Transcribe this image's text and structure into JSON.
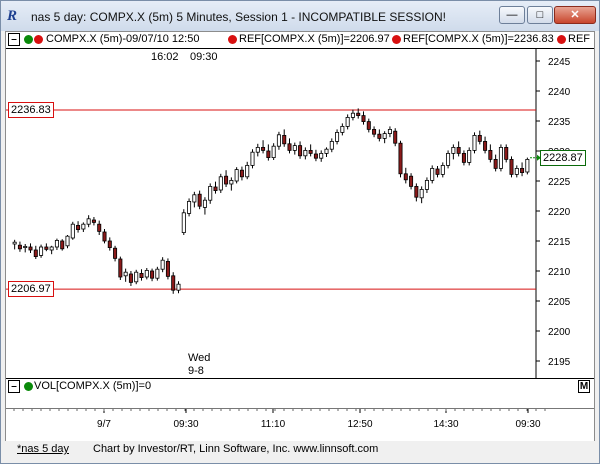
{
  "window": {
    "title": "nas 5 day: COMPX.X (5m) 5 Minutes, Session 1 - INCOMPATIBLE SESSION!",
    "app_icon": "R",
    "controls": {
      "minimize": "—",
      "maximize": "□",
      "close": "✕"
    }
  },
  "legend": {
    "main": "COMPX.X (5m)-09/07/10 12:50",
    "ref1": "REF[COMPX.X (5m)]=2206.97",
    "ref2": "REF[COMPX.X (5m)]=2236.83",
    "ref3": "REF",
    "corner_label": "M"
  },
  "chart_top_text": {
    "time1": "16:02",
    "time2": "09:30"
  },
  "annotation": {
    "day": "Wed",
    "date": "9-8"
  },
  "ref_labels": {
    "upper": "2236.83",
    "lower": "2206.97"
  },
  "last_price": "2228.87",
  "volume": {
    "label": "VOL[COMPX.X (5m)]=0",
    "corner_label": "M"
  },
  "x_axis_labels": [
    "9/7",
    "09:30",
    "11:10",
    "12:50",
    "14:30",
    "09:30"
  ],
  "status": {
    "tab": "*nas 5 day",
    "credit": "Chart by Investor/RT, Linn Software, Inc. www.linnsoft.com"
  },
  "colors": {
    "up": "#ffffff",
    "down": "#8b1a1a",
    "ref": "#d81010",
    "arrow": "#0a8a0a"
  },
  "chart_data": {
    "type": "candlestick",
    "ylabel": "",
    "ylim": [
      2192,
      2247
    ],
    "y_ticks": [
      2195,
      2200,
      2205,
      2210,
      2215,
      2220,
      2225,
      2230,
      2235,
      2240,
      2245
    ],
    "reference_lines": [
      2236.83,
      2206.97
    ],
    "last": 2228.87,
    "bars": [
      {
        "o": 2214.5,
        "h": 2215.2,
        "l": 2213.6,
        "c": 2214.8
      },
      {
        "o": 2214.3,
        "h": 2214.9,
        "l": 2213.2,
        "c": 2213.7
      },
      {
        "o": 2213.9,
        "h": 2214.5,
        "l": 2213.1,
        "c": 2214.1
      },
      {
        "o": 2214.0,
        "h": 2214.6,
        "l": 2213.0,
        "c": 2213.5
      },
      {
        "o": 2213.5,
        "h": 2214.2,
        "l": 2212.0,
        "c": 2212.4
      },
      {
        "o": 2212.6,
        "h": 2214.4,
        "l": 2212.2,
        "c": 2214.0
      },
      {
        "o": 2214.0,
        "h": 2214.6,
        "l": 2213.3,
        "c": 2213.6
      },
      {
        "o": 2213.5,
        "h": 2214.2,
        "l": 2212.8,
        "c": 2214.0
      },
      {
        "o": 2214.0,
        "h": 2215.4,
        "l": 2213.5,
        "c": 2215.1
      },
      {
        "o": 2215.0,
        "h": 2215.3,
        "l": 2213.4,
        "c": 2213.7
      },
      {
        "o": 2214.2,
        "h": 2216.0,
        "l": 2213.8,
        "c": 2215.8
      },
      {
        "o": 2215.5,
        "h": 2218.2,
        "l": 2215.2,
        "c": 2217.8
      },
      {
        "o": 2217.6,
        "h": 2218.3,
        "l": 2216.4,
        "c": 2216.9
      },
      {
        "o": 2217.0,
        "h": 2218.1,
        "l": 2216.5,
        "c": 2217.8
      },
      {
        "o": 2217.8,
        "h": 2219.3,
        "l": 2217.3,
        "c": 2218.7
      },
      {
        "o": 2218.5,
        "h": 2219.0,
        "l": 2217.6,
        "c": 2218.1
      },
      {
        "o": 2217.8,
        "h": 2218.4,
        "l": 2216.0,
        "c": 2216.6
      },
      {
        "o": 2216.5,
        "h": 2217.0,
        "l": 2214.6,
        "c": 2215.0
      },
      {
        "o": 2215.0,
        "h": 2215.6,
        "l": 2213.4,
        "c": 2213.9
      },
      {
        "o": 2213.8,
        "h": 2214.2,
        "l": 2211.6,
        "c": 2212.1
      },
      {
        "o": 2212.0,
        "h": 2212.4,
        "l": 2208.5,
        "c": 2209.0
      },
      {
        "o": 2209.2,
        "h": 2210.4,
        "l": 2208.2,
        "c": 2209.8
      },
      {
        "o": 2209.5,
        "h": 2210.0,
        "l": 2207.5,
        "c": 2208.1
      },
      {
        "o": 2208.2,
        "h": 2210.2,
        "l": 2207.8,
        "c": 2209.8
      },
      {
        "o": 2209.6,
        "h": 2210.3,
        "l": 2208.4,
        "c": 2208.9
      },
      {
        "o": 2209.0,
        "h": 2210.5,
        "l": 2208.6,
        "c": 2210.1
      },
      {
        "o": 2210.0,
        "h": 2210.4,
        "l": 2208.3,
        "c": 2208.8
      },
      {
        "o": 2208.8,
        "h": 2210.7,
        "l": 2208.4,
        "c": 2210.3
      },
      {
        "o": 2210.3,
        "h": 2212.3,
        "l": 2209.8,
        "c": 2211.8
      },
      {
        "o": 2211.6,
        "h": 2212.1,
        "l": 2208.6,
        "c": 2209.1
      },
      {
        "o": 2209.2,
        "h": 2209.8,
        "l": 2206.2,
        "c": 2206.8
      },
      {
        "o": 2206.8,
        "h": 2208.3,
        "l": 2206.3,
        "c": 2207.8
      },
      {
        "o": 2216.4,
        "h": 2220.3,
        "l": 2216.0,
        "c": 2219.7
      },
      {
        "o": 2219.6,
        "h": 2222.1,
        "l": 2219.1,
        "c": 2221.6
      },
      {
        "o": 2221.5,
        "h": 2223.2,
        "l": 2220.6,
        "c": 2222.7
      },
      {
        "o": 2222.8,
        "h": 2223.4,
        "l": 2220.3,
        "c": 2220.8
      },
      {
        "o": 2220.6,
        "h": 2222.3,
        "l": 2219.4,
        "c": 2221.8
      },
      {
        "o": 2221.8,
        "h": 2224.6,
        "l": 2221.2,
        "c": 2224.1
      },
      {
        "o": 2224.0,
        "h": 2224.9,
        "l": 2222.9,
        "c": 2223.4
      },
      {
        "o": 2223.5,
        "h": 2226.2,
        "l": 2223.0,
        "c": 2225.7
      },
      {
        "o": 2225.8,
        "h": 2226.8,
        "l": 2224.0,
        "c": 2224.5
      },
      {
        "o": 2224.5,
        "h": 2225.6,
        "l": 2223.4,
        "c": 2225.1
      },
      {
        "o": 2225.0,
        "h": 2227.3,
        "l": 2224.6,
        "c": 2226.9
      },
      {
        "o": 2226.8,
        "h": 2227.4,
        "l": 2225.1,
        "c": 2225.7
      },
      {
        "o": 2225.7,
        "h": 2228.2,
        "l": 2225.3,
        "c": 2227.6
      },
      {
        "o": 2227.6,
        "h": 2230.3,
        "l": 2227.1,
        "c": 2229.8
      },
      {
        "o": 2229.8,
        "h": 2231.2,
        "l": 2229.1,
        "c": 2230.6
      },
      {
        "o": 2230.6,
        "h": 2231.8,
        "l": 2229.6,
        "c": 2230.1
      },
      {
        "o": 2230.0,
        "h": 2231.1,
        "l": 2228.4,
        "c": 2228.9
      },
      {
        "o": 2228.9,
        "h": 2231.3,
        "l": 2228.5,
        "c": 2230.8
      },
      {
        "o": 2230.8,
        "h": 2233.2,
        "l": 2230.2,
        "c": 2232.7
      },
      {
        "o": 2232.6,
        "h": 2233.6,
        "l": 2230.7,
        "c": 2231.2
      },
      {
        "o": 2231.2,
        "h": 2232.1,
        "l": 2229.6,
        "c": 2230.1
      },
      {
        "o": 2230.1,
        "h": 2231.4,
        "l": 2229.4,
        "c": 2230.9
      },
      {
        "o": 2230.9,
        "h": 2231.6,
        "l": 2228.7,
        "c": 2229.2
      },
      {
        "o": 2229.2,
        "h": 2230.6,
        "l": 2228.6,
        "c": 2230.1
      },
      {
        "o": 2230.1,
        "h": 2231.1,
        "l": 2229.1,
        "c": 2229.6
      },
      {
        "o": 2229.5,
        "h": 2230.2,
        "l": 2228.3,
        "c": 2228.8
      },
      {
        "o": 2228.8,
        "h": 2230.1,
        "l": 2228.2,
        "c": 2229.6
      },
      {
        "o": 2229.6,
        "h": 2230.6,
        "l": 2229.0,
        "c": 2230.3
      },
      {
        "o": 2230.3,
        "h": 2232.1,
        "l": 2229.8,
        "c": 2231.6
      },
      {
        "o": 2231.6,
        "h": 2233.6,
        "l": 2231.1,
        "c": 2233.1
      },
      {
        "o": 2233.1,
        "h": 2234.6,
        "l": 2232.6,
        "c": 2234.1
      },
      {
        "o": 2234.1,
        "h": 2236.1,
        "l": 2233.6,
        "c": 2235.6
      },
      {
        "o": 2235.6,
        "h": 2236.9,
        "l": 2235.1,
        "c": 2236.3
      },
      {
        "o": 2236.3,
        "h": 2237.1,
        "l": 2235.4,
        "c": 2235.9
      },
      {
        "o": 2235.9,
        "h": 2236.6,
        "l": 2234.4,
        "c": 2234.9
      },
      {
        "o": 2234.9,
        "h": 2235.4,
        "l": 2233.1,
        "c": 2233.6
      },
      {
        "o": 2233.6,
        "h": 2234.1,
        "l": 2232.3,
        "c": 2232.8
      },
      {
        "o": 2232.8,
        "h": 2233.6,
        "l": 2231.6,
        "c": 2232.1
      },
      {
        "o": 2232.1,
        "h": 2233.3,
        "l": 2231.3,
        "c": 2232.9
      },
      {
        "o": 2232.9,
        "h": 2234.1,
        "l": 2232.3,
        "c": 2233.6
      },
      {
        "o": 2233.3,
        "h": 2233.8,
        "l": 2230.8,
        "c": 2231.3
      },
      {
        "o": 2231.3,
        "h": 2231.7,
        "l": 2225.6,
        "c": 2226.2
      },
      {
        "o": 2226.2,
        "h": 2227.2,
        "l": 2224.6,
        "c": 2225.2
      },
      {
        "o": 2225.8,
        "h": 2226.3,
        "l": 2223.6,
        "c": 2224.1
      },
      {
        "o": 2224.1,
        "h": 2224.6,
        "l": 2221.6,
        "c": 2222.3
      },
      {
        "o": 2222.2,
        "h": 2224.1,
        "l": 2221.3,
        "c": 2223.6
      },
      {
        "o": 2223.6,
        "h": 2225.6,
        "l": 2223.0,
        "c": 2225.1
      },
      {
        "o": 2225.1,
        "h": 2227.6,
        "l": 2224.6,
        "c": 2227.1
      },
      {
        "o": 2227.0,
        "h": 2227.5,
        "l": 2225.6,
        "c": 2226.1
      },
      {
        "o": 2226.1,
        "h": 2228.1,
        "l": 2225.6,
        "c": 2227.6
      },
      {
        "o": 2227.6,
        "h": 2230.1,
        "l": 2227.1,
        "c": 2229.6
      },
      {
        "o": 2229.6,
        "h": 2231.1,
        "l": 2228.6,
        "c": 2230.6
      },
      {
        "o": 2230.6,
        "h": 2231.6,
        "l": 2229.1,
        "c": 2229.6
      },
      {
        "o": 2229.6,
        "h": 2230.1,
        "l": 2227.6,
        "c": 2228.1
      },
      {
        "o": 2228.1,
        "h": 2230.6,
        "l": 2227.6,
        "c": 2230.1
      },
      {
        "o": 2230.1,
        "h": 2233.1,
        "l": 2229.6,
        "c": 2232.6
      },
      {
        "o": 2232.6,
        "h": 2233.4,
        "l": 2231.1,
        "c": 2231.6
      },
      {
        "o": 2231.6,
        "h": 2232.4,
        "l": 2229.6,
        "c": 2230.1
      },
      {
        "o": 2230.1,
        "h": 2231.1,
        "l": 2228.1,
        "c": 2228.6
      },
      {
        "o": 2228.6,
        "h": 2229.4,
        "l": 2226.6,
        "c": 2227.1
      },
      {
        "o": 2227.1,
        "h": 2231.1,
        "l": 2226.6,
        "c": 2230.6
      },
      {
        "o": 2230.6,
        "h": 2231.1,
        "l": 2228.1,
        "c": 2228.6
      },
      {
        "o": 2228.6,
        "h": 2229.1,
        "l": 2225.6,
        "c": 2226.1
      },
      {
        "o": 2226.1,
        "h": 2227.6,
        "l": 2225.6,
        "c": 2227.1
      },
      {
        "o": 2227.1,
        "h": 2228.1,
        "l": 2225.8,
        "c": 2226.4
      },
      {
        "o": 2226.5,
        "h": 2228.9,
        "l": 2226.1,
        "c": 2228.6
      }
    ]
  }
}
